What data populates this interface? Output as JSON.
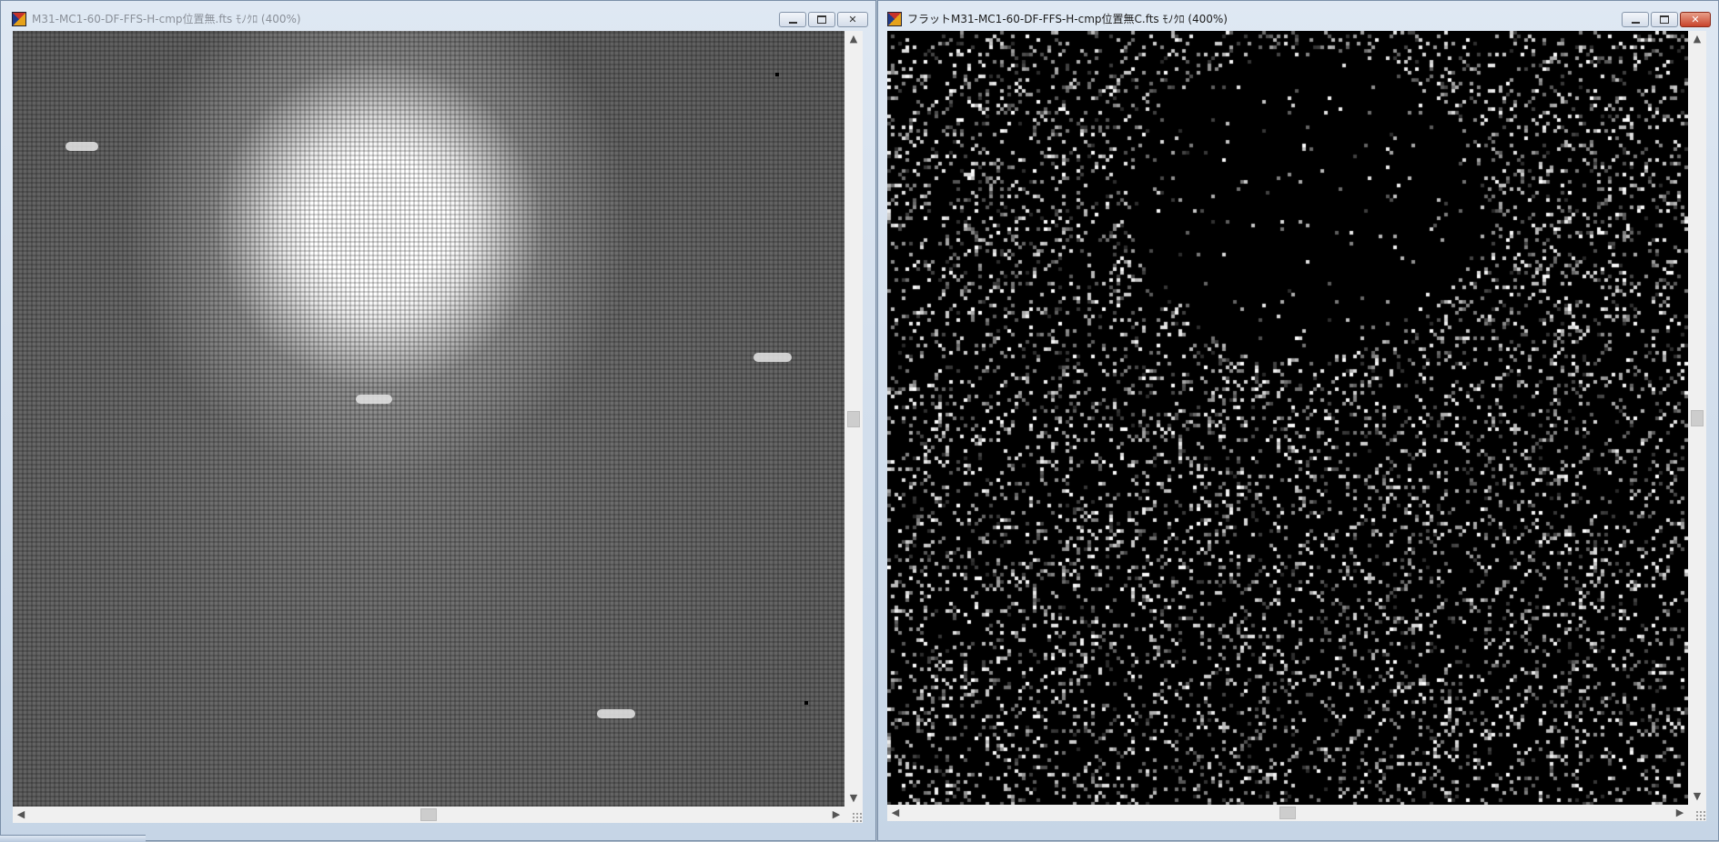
{
  "windows": {
    "left": {
      "title": "M31-MC1-60-DF-FFS-H-cmp位置無.fts ﾓﾉｸﾛ (400%)",
      "active": false
    },
    "right": {
      "title": "フラットM31-MC1-60-DF-FFS-H-cmp位置無C.fts ﾓﾉｸﾛ (400%)",
      "active": true
    }
  },
  "icons": {
    "app": "app-icon",
    "minimize": "minimize-icon",
    "maximize": "maximize-icon",
    "close": "close-icon",
    "scroll_up": "▲",
    "scroll_down": "▼",
    "scroll_left": "◀",
    "scroll_right": "▶"
  },
  "colors": {
    "noise_background": "#000000",
    "noise_dot": "#ffffff",
    "left_background": "#5c5c5c"
  }
}
